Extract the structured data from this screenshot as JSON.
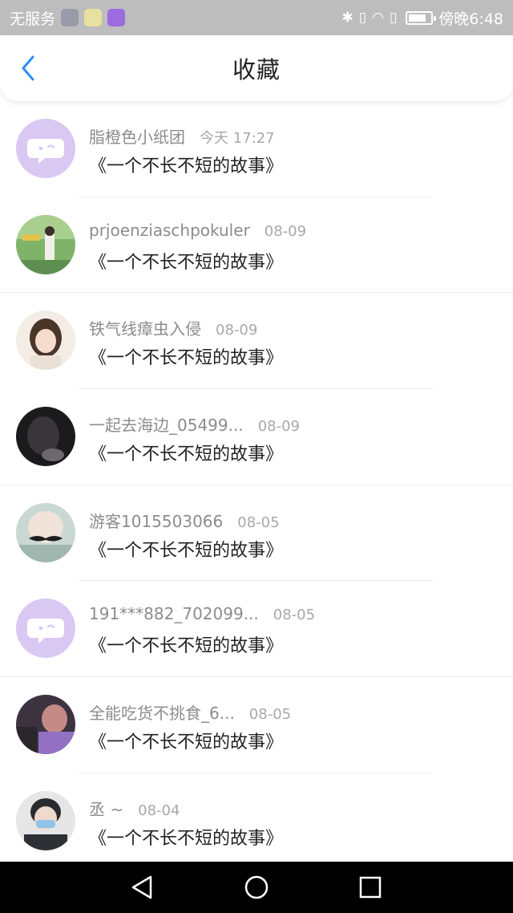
{
  "status_bar": {
    "carrier": "无服务",
    "time": "傍晚6:48"
  },
  "header": {
    "title": "收藏"
  },
  "items": [
    {
      "user": "脂橙色小纸团",
      "date": "今天 17:27",
      "title": "《一个不长不短的故事》",
      "avatar": "default-chat"
    },
    {
      "user": "prjoenziaschpokuler",
      "date": "08-09",
      "title": "《一个不长不短的故事》",
      "avatar": "photo-green"
    },
    {
      "user": "铁气线瘴虫入侵",
      "date": "08-09",
      "title": "《一个不长不短的故事》",
      "avatar": "photo-girl"
    },
    {
      "user": "一起去海边_05499...",
      "date": "08-09",
      "title": "《一个不长不短的故事》",
      "avatar": "photo-dark"
    },
    {
      "user": "游客1015503066",
      "date": "08-05",
      "title": "《一个不长不短的故事》",
      "avatar": "photo-mustache"
    },
    {
      "user": "191***882_702099...",
      "date": "08-05",
      "title": "《一个不长不短的故事》",
      "avatar": "default-chat"
    },
    {
      "user": "全能吃货不挑食_6...",
      "date": "08-05",
      "title": "《一个不长不短的故事》",
      "avatar": "photo-purple"
    },
    {
      "user": "丞 ~",
      "date": "08-04",
      "title": "《一个不长不短的故事》",
      "avatar": "photo-mask"
    }
  ],
  "colors": {
    "accent": "#2a8ff7",
    "default_avatar": "#d9c8f2"
  }
}
